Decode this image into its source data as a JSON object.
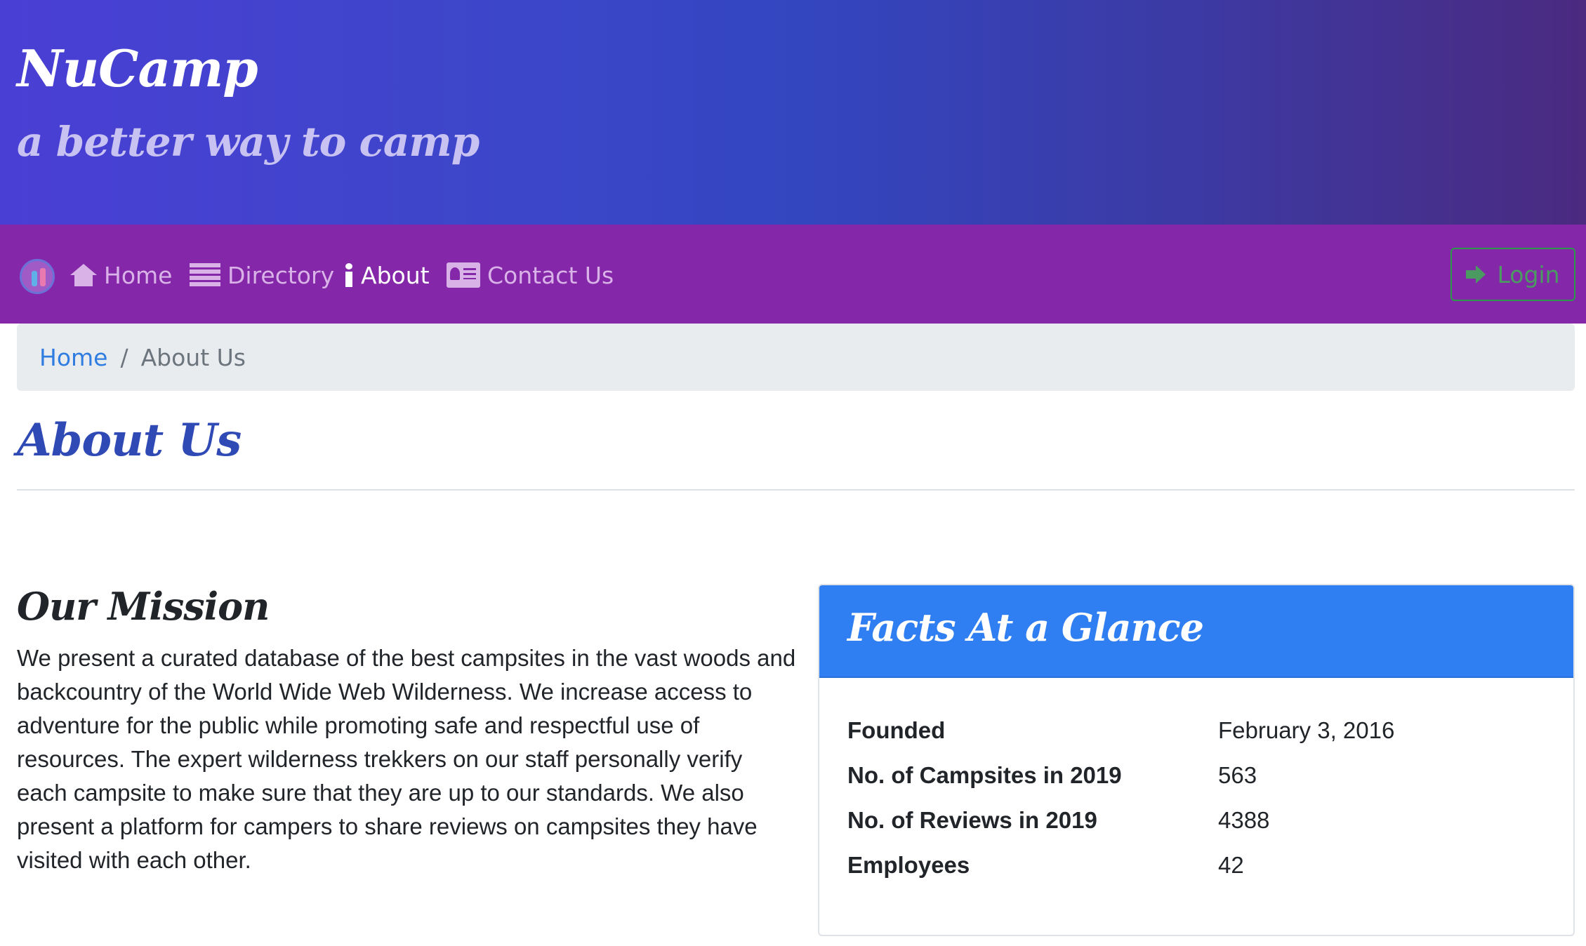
{
  "header": {
    "brand": "NuCamp",
    "tagline": "a better way to camp"
  },
  "nav": {
    "logo": "nucamp-logo-icon",
    "items": [
      {
        "label": "Home",
        "icon": "home-icon",
        "active": false
      },
      {
        "label": "Directory",
        "icon": "list-icon",
        "active": false
      },
      {
        "label": "About",
        "icon": "info-icon",
        "active": true
      },
      {
        "label": "Contact Us",
        "icon": "address-card-icon",
        "active": false
      }
    ],
    "login": {
      "label": "Login",
      "icon": "sign-in-icon"
    }
  },
  "breadcrumb": {
    "home": "Home",
    "separator": "/",
    "current": "About Us"
  },
  "page": {
    "title": "About Us"
  },
  "mission": {
    "title": "Our Mission",
    "text": "We present a curated database of the best campsites in the vast woods and backcountry of the World Wide Web Wilderness. We increase access to adventure for the public while promoting safe and respectful use of resources. The expert wilderness trekkers on our staff personally verify each campsite to make sure that they are up to our standards. We also present a platform for campers to share reviews on campsites they have visited with each other."
  },
  "facts": {
    "title": "Facts At a Glance",
    "rows": [
      {
        "term": "Founded",
        "value": "February 3, 2016"
      },
      {
        "term": "No. of Campsites in 2019",
        "value": "563"
      },
      {
        "term": "No. of Reviews in 2019",
        "value": "4388"
      },
      {
        "term": "Employees",
        "value": "42"
      }
    ]
  },
  "colors": {
    "navbar": "#8427a8",
    "card_header": "#2f7ef2",
    "title_blue": "#2f49b5",
    "link": "#2f7de1",
    "login_border": "#2a9a4a"
  }
}
